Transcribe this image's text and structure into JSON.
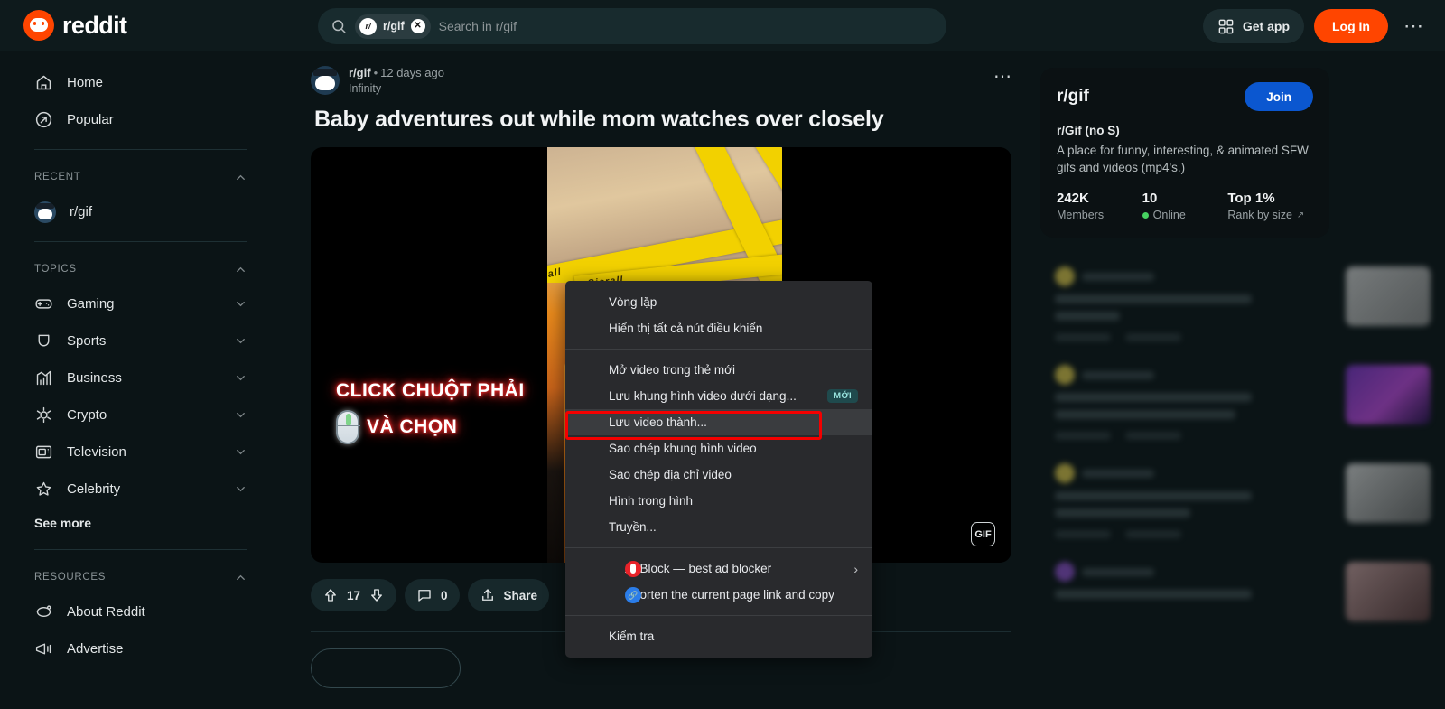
{
  "header": {
    "brand": "reddit",
    "search": {
      "chip_label": "r/gif",
      "chip_avatar_text": "r/",
      "placeholder": "Search in r/gif",
      "value": ""
    },
    "get_app": "Get app",
    "log_in": "Log In",
    "more": "⋯"
  },
  "sidebar": {
    "primary": [
      {
        "label": "Home",
        "icon": "home-icon"
      },
      {
        "label": "Popular",
        "icon": "popular-arrow-icon"
      }
    ],
    "recent": {
      "title": "RECENT",
      "items": [
        {
          "label": "r/gif",
          "icon": "subreddit-avatar"
        }
      ]
    },
    "topics": {
      "title": "TOPICS",
      "items": [
        {
          "label": "Gaming",
          "icon": "gamepad-icon"
        },
        {
          "label": "Sports",
          "icon": "sports-icon"
        },
        {
          "label": "Business",
          "icon": "chart-icon"
        },
        {
          "label": "Crypto",
          "icon": "crypto-icon"
        },
        {
          "label": "Television",
          "icon": "television-icon"
        },
        {
          "label": "Celebrity",
          "icon": "star-icon"
        }
      ],
      "see_more": "See more"
    },
    "resources": {
      "title": "RESOURCES",
      "items": [
        {
          "label": "About Reddit",
          "icon": "reddit-snoo-icon"
        },
        {
          "label": "Advertise",
          "icon": "megaphone-icon"
        }
      ]
    }
  },
  "post": {
    "subreddit": "r/gif",
    "separator": "•",
    "time": "12 days ago",
    "flair": "Infinity",
    "title": "Baby adventures out while mom watches over closely",
    "media_badge": "GIF",
    "overlay_line1": "CLICK CHUỘT PHẢI",
    "overlay_line2": "VÀ CHỌN",
    "tape_text": "Sicrall",
    "actions": {
      "score": "17",
      "comments": "0",
      "share": "Share"
    }
  },
  "community": {
    "name": "r/gif",
    "join": "Join",
    "subtitle": "r/Gif (no S)",
    "description": "A place for funny, interesting, & animated SFW gifs and videos (mp4's.)",
    "stats": [
      {
        "value": "242K",
        "label": "Members",
        "online": false,
        "external": false
      },
      {
        "value": "10",
        "label": "Online",
        "online": true,
        "external": false
      },
      {
        "value": "Top 1%",
        "label": "Rank by size",
        "online": false,
        "external": true
      }
    ]
  },
  "context_menu": {
    "groups": [
      {
        "items": [
          {
            "label": "Vòng lặp"
          },
          {
            "label": "Hiển thị tất cả nút điều khiển"
          }
        ]
      },
      {
        "items": [
          {
            "label": "Mở video trong thẻ mới"
          },
          {
            "label": "Lưu khung hình video dưới dạng...",
            "badge": "MỚI"
          },
          {
            "label": "Lưu video thành...",
            "highlighted": true
          },
          {
            "label": "Sao chép khung hình video"
          },
          {
            "label": "Sao chép địa chỉ video"
          },
          {
            "label": "Hình trong hình"
          },
          {
            "label": "Truyền..."
          }
        ]
      },
      {
        "items": [
          {
            "label": "AdBlock — best ad blocker",
            "icon": "adblock-icon",
            "submenu": "›"
          },
          {
            "label": "Shorten the current page link and copy",
            "icon": "shorten-link-icon"
          }
        ]
      },
      {
        "items": [
          {
            "label": "Kiểm tra"
          }
        ]
      }
    ]
  },
  "colors": {
    "brand_orange": "#ff4500",
    "join_blue": "#0b57d0",
    "online_green": "#46d160",
    "highlight_red": "#f40000",
    "badge_teal": "#1f4a4d",
    "page_bg": "#0b1416"
  }
}
